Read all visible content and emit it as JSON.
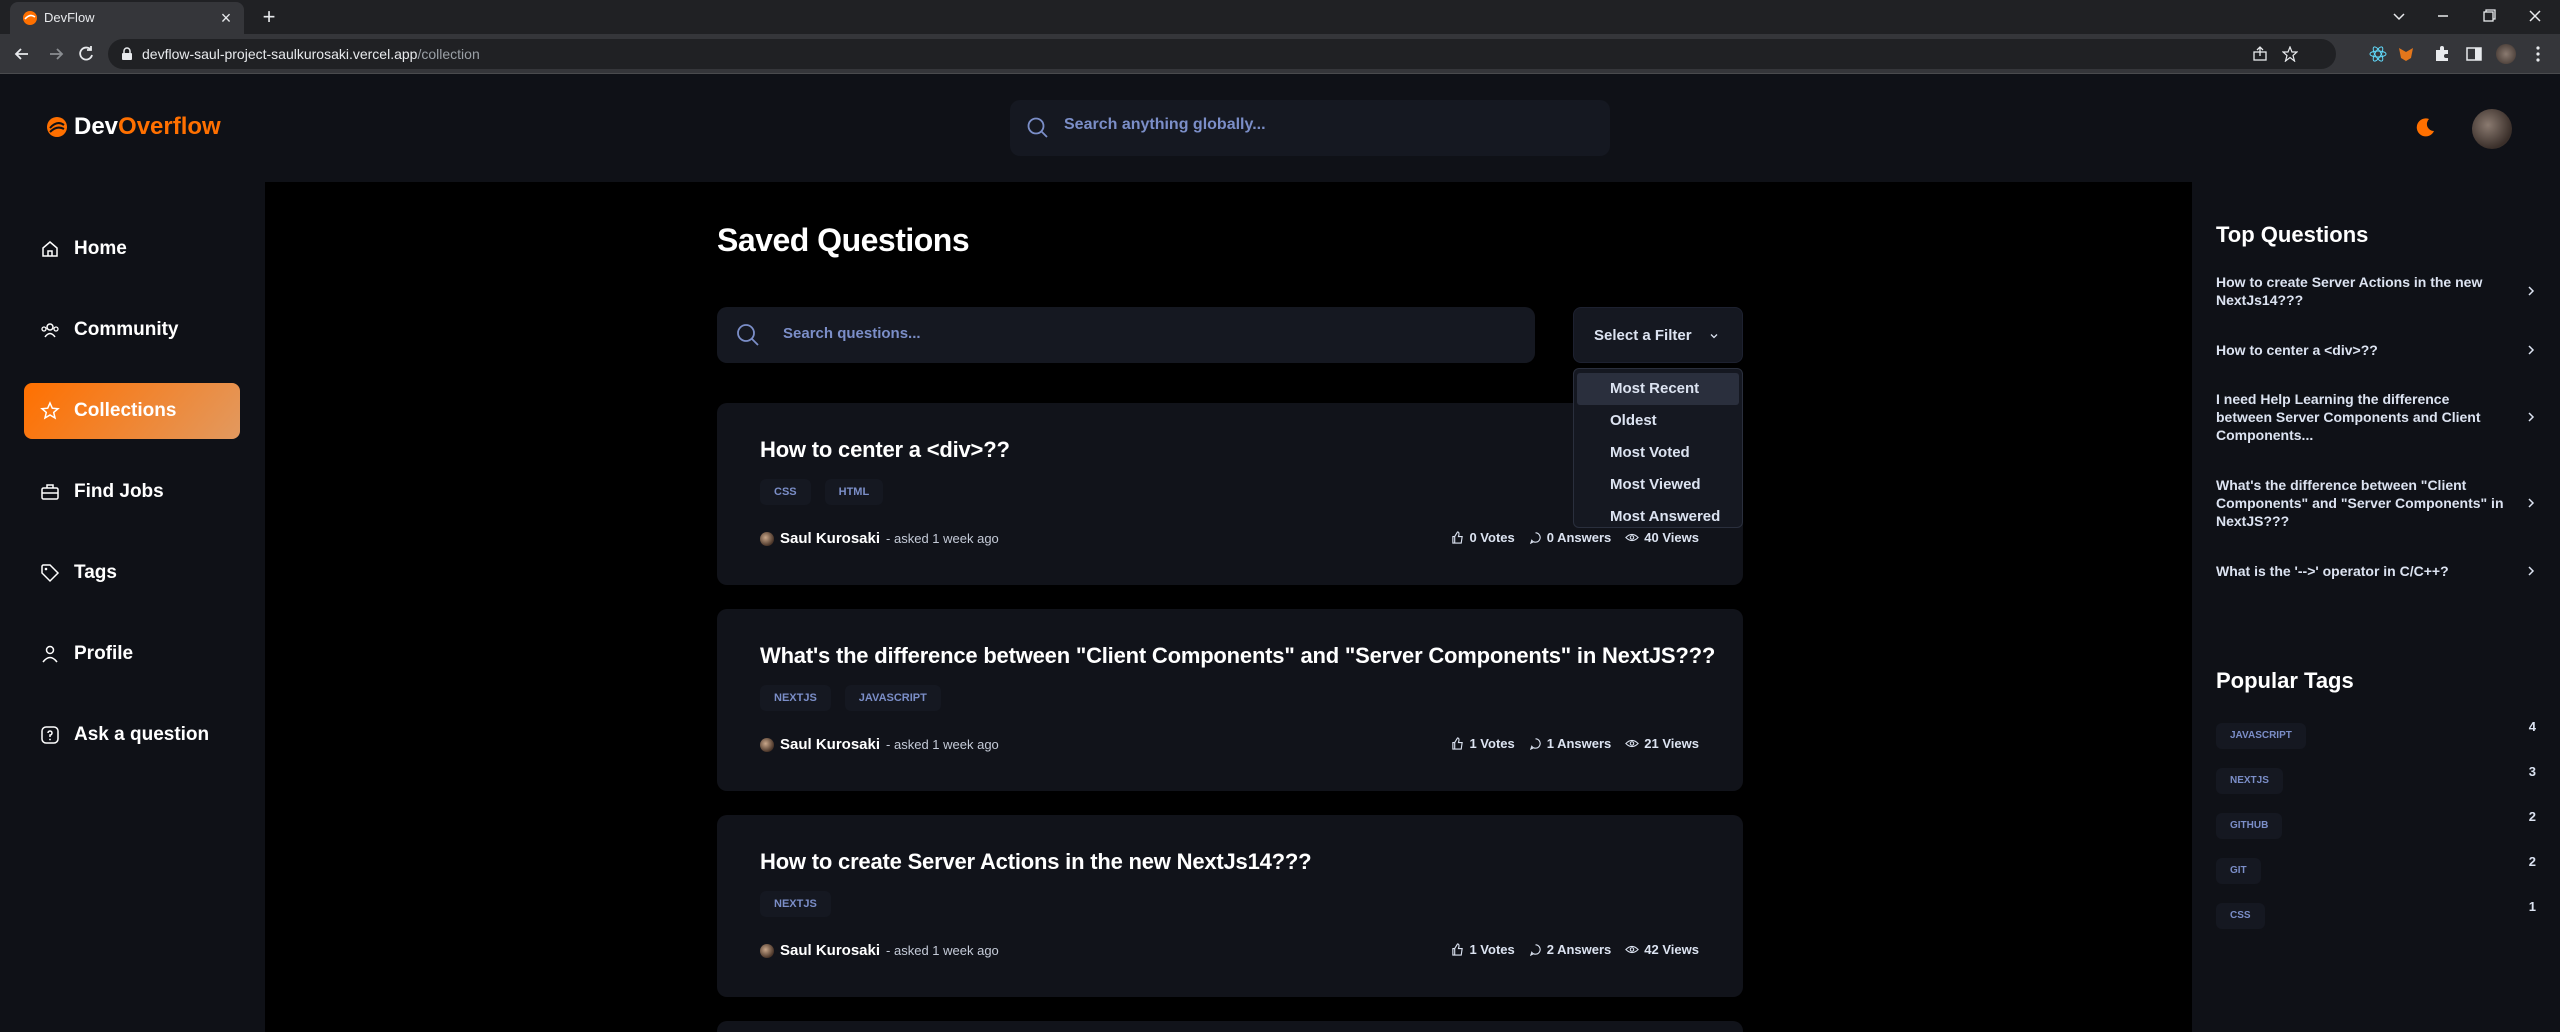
{
  "browser": {
    "tab_title": "DevFlow",
    "url_host": "devflow-saul-project-saulkurosaki.vercel.app",
    "url_path": "/collection"
  },
  "header": {
    "brand_prefix": "Dev",
    "brand_suffix": "Overflow",
    "search_placeholder": "Search anything globally..."
  },
  "sidebar": {
    "items": [
      {
        "label": "Home",
        "icon": "home-icon"
      },
      {
        "label": "Community",
        "icon": "users-icon"
      },
      {
        "label": "Collections",
        "icon": "star-icon",
        "active": true
      },
      {
        "label": "Find Jobs",
        "icon": "suitcase-icon"
      },
      {
        "label": "Tags",
        "icon": "tag-icon"
      },
      {
        "label": "Profile",
        "icon": "user-icon"
      },
      {
        "label": "Ask a question",
        "icon": "question-icon"
      }
    ]
  },
  "main": {
    "title": "Saved Questions",
    "search_placeholder": "Search questions...",
    "filter_label": "Select a Filter",
    "filter_options": [
      "Most Recent",
      "Oldest",
      "Most Voted",
      "Most Viewed",
      "Most Answered"
    ],
    "questions": [
      {
        "title": "How to center a <div>??",
        "tags": [
          "CSS",
          "HTML"
        ],
        "author": "Saul Kurosaki",
        "ago": "- asked 1 week ago",
        "votes": "0 Votes",
        "answers": "0 Answers",
        "views": "40 Views"
      },
      {
        "title": "What's the difference between \"Client Components\" and \"Server Components\" in NextJS???",
        "tags": [
          "NEXTJS",
          "JAVASCRIPT"
        ],
        "author": "Saul Kurosaki",
        "ago": "- asked 1 week ago",
        "votes": "1 Votes",
        "answers": "1 Answers",
        "views": "21 Views"
      },
      {
        "title": "How to create Server Actions in the new NextJs14???",
        "tags": [
          "NEXTJS"
        ],
        "author": "Saul Kurosaki",
        "ago": "- asked 1 week ago",
        "votes": "1 Votes",
        "answers": "2 Answers",
        "views": "42 Views"
      }
    ]
  },
  "right": {
    "top_title": "Top Questions",
    "top_questions": [
      "How to create Server Actions in the new NextJs14???",
      "How to center a <div>??",
      "I need Help Learning the difference between Server Components and Client Components...",
      "What's the difference between \"Client Components\" and \"Server Components\" in NextJS???",
      "What is the '-->' operator in C/C++?"
    ],
    "tags_title": "Popular Tags",
    "popular_tags": [
      {
        "name": "JAVASCRIPT",
        "count": "4"
      },
      {
        "name": "NEXTJS",
        "count": "3"
      },
      {
        "name": "GITHUB",
        "count": "2"
      },
      {
        "name": "GIT",
        "count": "2"
      },
      {
        "name": "CSS",
        "count": "1"
      }
    ]
  },
  "colors": {
    "accent": "#ff7000",
    "link": "#7b8ec8",
    "surface": "#0f1117"
  }
}
